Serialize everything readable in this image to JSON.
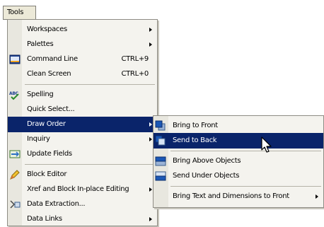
{
  "menubar": {
    "tools_label": "Tools"
  },
  "menu": {
    "items": [
      {
        "label": "Workspaces",
        "shortcut": "",
        "submenu": true,
        "icon": ""
      },
      {
        "label": "Palettes",
        "shortcut": "",
        "submenu": true,
        "icon": ""
      },
      {
        "label": "Command Line",
        "shortcut": "CTRL+9",
        "submenu": false,
        "icon": "command-line-icon"
      },
      {
        "label": "Clean Screen",
        "shortcut": "CTRL+0",
        "submenu": false,
        "icon": ""
      },
      {
        "label": "Spelling",
        "shortcut": "",
        "submenu": false,
        "icon": "spelling-icon"
      },
      {
        "label": "Quick Select...",
        "shortcut": "",
        "submenu": false,
        "icon": ""
      },
      {
        "label": "Draw Order",
        "shortcut": "",
        "submenu": true,
        "icon": "",
        "highlighted": true
      },
      {
        "label": "Inquiry",
        "shortcut": "",
        "submenu": true,
        "icon": ""
      },
      {
        "label": "Update Fields",
        "shortcut": "",
        "submenu": false,
        "icon": "update-fields-icon"
      },
      {
        "label": "Block Editor",
        "shortcut": "",
        "submenu": false,
        "icon": "block-editor-icon"
      },
      {
        "label": "Xref and Block In-place Editing",
        "shortcut": "",
        "submenu": true,
        "icon": ""
      },
      {
        "label": "Data Extraction...",
        "shortcut": "",
        "submenu": false,
        "icon": "data-extraction-icon"
      },
      {
        "label": "Data Links",
        "shortcut": "",
        "submenu": true,
        "icon": ""
      }
    ]
  },
  "submenu": {
    "items": [
      {
        "label": "Bring to Front",
        "icon": "bring-to-front-icon"
      },
      {
        "label": "Send to Back",
        "icon": "send-to-back-icon",
        "highlighted": true
      },
      {
        "label": "Bring Above Objects",
        "icon": "bring-above-objects-icon"
      },
      {
        "label": "Send Under Objects",
        "icon": "send-under-objects-icon"
      },
      {
        "label": "Bring Text and Dimensions to Front",
        "icon": ""
      }
    ]
  },
  "colors": {
    "highlight": "#0a246a",
    "menu_bg": "#f4f3ee"
  }
}
